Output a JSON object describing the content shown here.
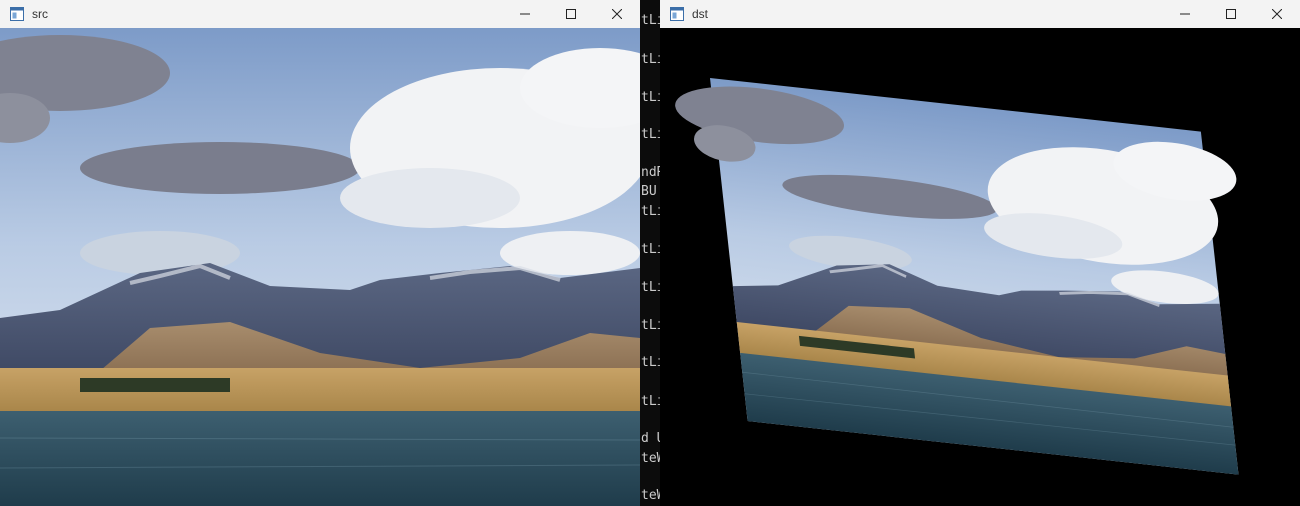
{
  "src_window": {
    "title": "src",
    "icon": "app-window-icon",
    "controls": [
      "minimize-icon",
      "maximize-icon",
      "close-icon"
    ]
  },
  "dst_window": {
    "title": "dst",
    "icon": "app-window-icon",
    "controls": [
      "minimize-icon",
      "maximize-icon",
      "close-icon"
    ]
  },
  "console": {
    "lines": [
      "tLi",
      "tLi",
      "tLi",
      "tLi",
      "ndR",
      "BU",
      "tLi",
      "tLi",
      "tLi",
      "tLi",
      "tLi",
      "tLi",
      "d U",
      "teW",
      "teW"
    ]
  },
  "colors": {
    "titlebar": "#f3f3f3",
    "console_bg": "#0c0c0c",
    "console_text": "#cccccc",
    "image_background": "#000000"
  }
}
